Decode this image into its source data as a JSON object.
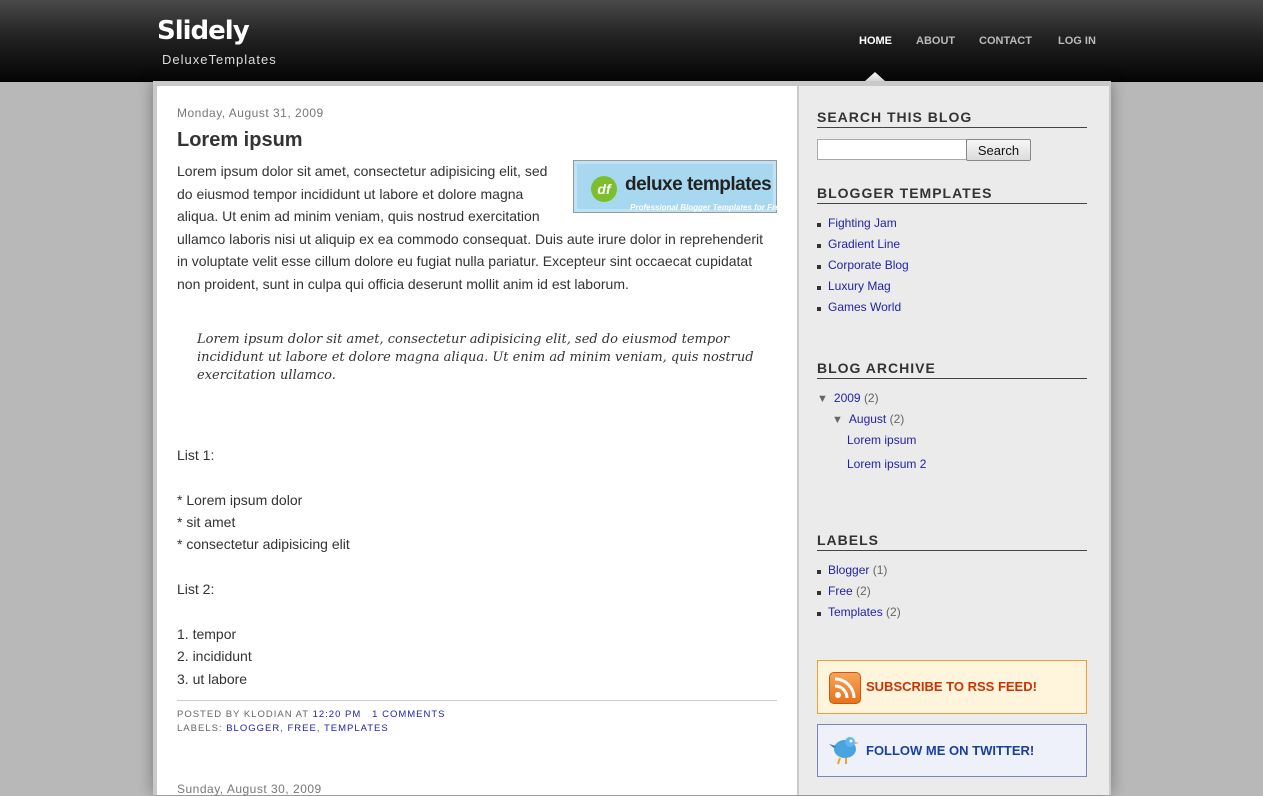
{
  "header": {
    "title": "Slidely",
    "description": "DeluxeTemplates",
    "nav": [
      {
        "label": "HOME",
        "active": true
      },
      {
        "label": "ABOUT",
        "active": false
      },
      {
        "label": "CONTACT",
        "active": false
      },
      {
        "label": "LOG IN",
        "active": false
      }
    ]
  },
  "post": {
    "date": "Monday, August 31, 2009",
    "title": "Lorem ipsum",
    "body": "Lorem ipsum dolor sit amet, consectetur adipisicing elit, sed do eiusmod tempor incididunt ut labore et dolore magna aliqua. Ut enim ad minim veniam, quis nostrud exercitation ullamco laboris nisi ut aliquip ex ea commodo consequat. Duis aute irure dolor in reprehenderit in voluptate velit esse cillum dolore eu fugiat nulla pariatur. Excepteur sint occaecat cupidatat non proident, sunt in culpa qui officia deserunt mollit anim id est laborum.",
    "image": {
      "logo_mark": "df",
      "logo_text": "deluxe templates",
      "logo_sub": "Professional Blogger Templates for Free"
    },
    "quote": "Lorem ipsum dolor sit amet, consectetur adipisicing elit, sed do eiusmod tempor incididunt ut labore et dolore magna aliqua. Ut enim ad minim veniam, quis nostrud exercitation ullamco.",
    "list1_title": "List 1:",
    "list1": [
      "* Lorem ipsum dolor",
      "* sit amet",
      "* consectetur adipisicing elit"
    ],
    "list2_title": "List 2:",
    "list2": [
      "1. tempor",
      "2. incididunt",
      "3. ut labore"
    ],
    "footer": {
      "posted_by": "Posted by Klodian at",
      "time": "12:20 PM",
      "comments": "1 comments",
      "labels_prefix": "Labels:",
      "labels": [
        "Blogger",
        "Free",
        "Templates"
      ]
    }
  },
  "next_post_date": "Sunday, August 30, 2009",
  "sidebar": {
    "search": {
      "title": "SEARCH THIS BLOG",
      "placeholder": "",
      "button": "Search"
    },
    "templates": {
      "title": "BLOGGER TEMPLATES",
      "items": [
        "Fighting Jam",
        "Gradient Line",
        "Corporate Blog",
        "Luxury Mag",
        "Games World"
      ]
    },
    "archive": {
      "title": "BLOG ARCHIVE",
      "year": {
        "label": "2009",
        "count": "(2)"
      },
      "month": {
        "label": "August",
        "count": "(2)"
      },
      "posts": [
        "Lorem ipsum",
        "Lorem ipsum 2"
      ]
    },
    "labels": {
      "title": "LABELS",
      "items": [
        {
          "label": "Blogger",
          "count": "(1)"
        },
        {
          "label": "Free",
          "count": "(2)"
        },
        {
          "label": "Templates",
          "count": "(2)"
        }
      ]
    },
    "rss": {
      "label": "SUBSCRIBE TO RSS FEED!",
      "icon": "rss-icon"
    },
    "twitter": {
      "label": "FOLLOW ME ON TWITTER!",
      "icon": "twitter-bird-icon"
    }
  },
  "colors": {
    "link": "#2222aa",
    "rss": "#cc3300",
    "twitter": "#1a3fa0"
  }
}
